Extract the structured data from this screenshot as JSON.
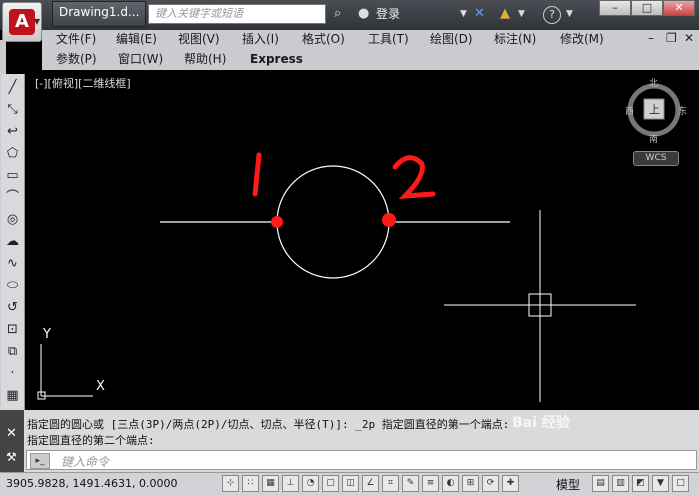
{
  "titlebar": {
    "doc_tab": "Drawing1.d...",
    "search_placeholder": "键入关键字或短语",
    "login_label": "登录",
    "help_label": "?"
  },
  "menu": {
    "row1": [
      "文件(F)",
      "编辑(E)",
      "视图(V)",
      "插入(I)",
      "格式(O)",
      "工具(T)",
      "绘图(D)",
      "标注(N)",
      "修改(M)"
    ],
    "row2": [
      "参数(P)",
      "窗口(W)",
      "帮助(H)",
      "Express"
    ]
  },
  "canvas": {
    "viewport_label": "[-][俯视][二维线框]",
    "annotation_1": "1",
    "annotation_2": "2",
    "viewcube": {
      "north": "北",
      "south": "南",
      "east": "东",
      "west": "西",
      "face": "上",
      "wcs": "WCS"
    },
    "ucs": {
      "y": "Y",
      "x": "X"
    }
  },
  "command": {
    "line1": "指定圆的圆心或 [三点(3P)/两点(2P)/切点、切点、半径(T)]: _2p 指定圆直径的第一个端点:",
    "line2": "指定圆直径的第二个端点:",
    "input_placeholder": "键入命令"
  },
  "status": {
    "coordinates": "3905.9828, 1491.4631, 0.0000",
    "model_tab": "模型"
  },
  "watermark": {
    "main": "Bai 经验",
    "sub": "cadbe12"
  },
  "colors": {
    "annotation_red": "#ff1a1a",
    "canvas_bg": "#000000",
    "geometry": "#ffffff"
  }
}
